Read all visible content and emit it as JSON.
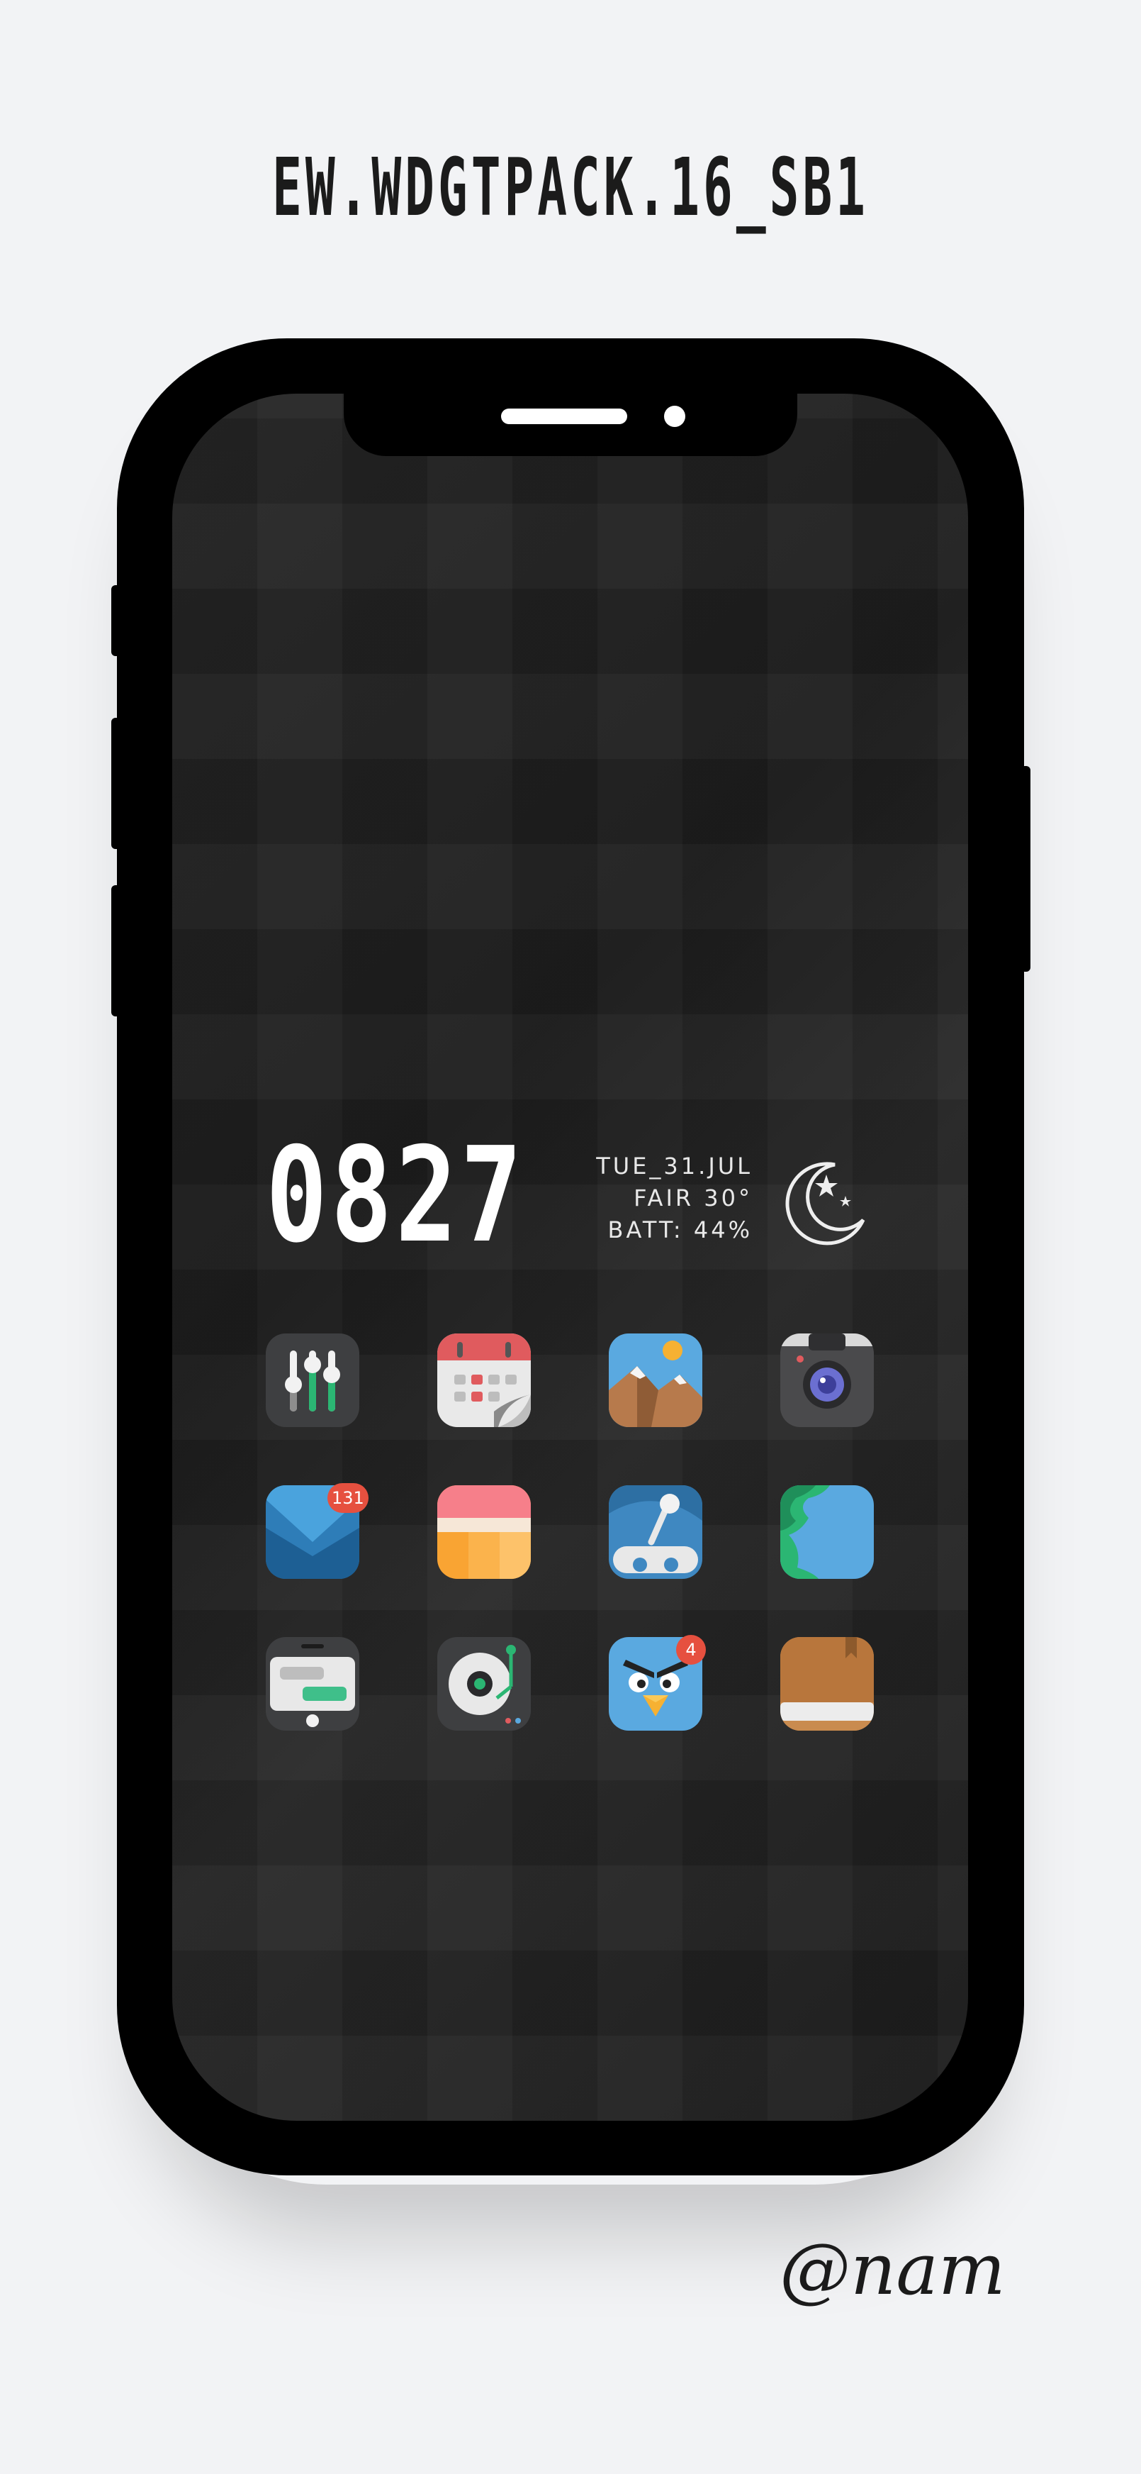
{
  "title": "EW.WDGTPACK.16_SB1",
  "widget": {
    "time": "0827",
    "date": "TUE_31.JUL",
    "weather": "FAIR 30°",
    "battery": "BATT: 44%",
    "weather_icon": "moon-star-icon"
  },
  "apps": [
    {
      "icon": "equalizer-icon"
    },
    {
      "icon": "calendar-icon"
    },
    {
      "icon": "gallery-icon"
    },
    {
      "icon": "camera-icon"
    },
    {
      "icon": "mail-icon",
      "badge": "131"
    },
    {
      "icon": "notes-icon"
    },
    {
      "icon": "rover-icon"
    },
    {
      "icon": "maps-icon"
    },
    {
      "icon": "messages-icon"
    },
    {
      "icon": "music-player-icon"
    },
    {
      "icon": "angry-birds-icon",
      "badge": "4"
    },
    {
      "icon": "book-icon"
    }
  ],
  "signature": "@nam"
}
